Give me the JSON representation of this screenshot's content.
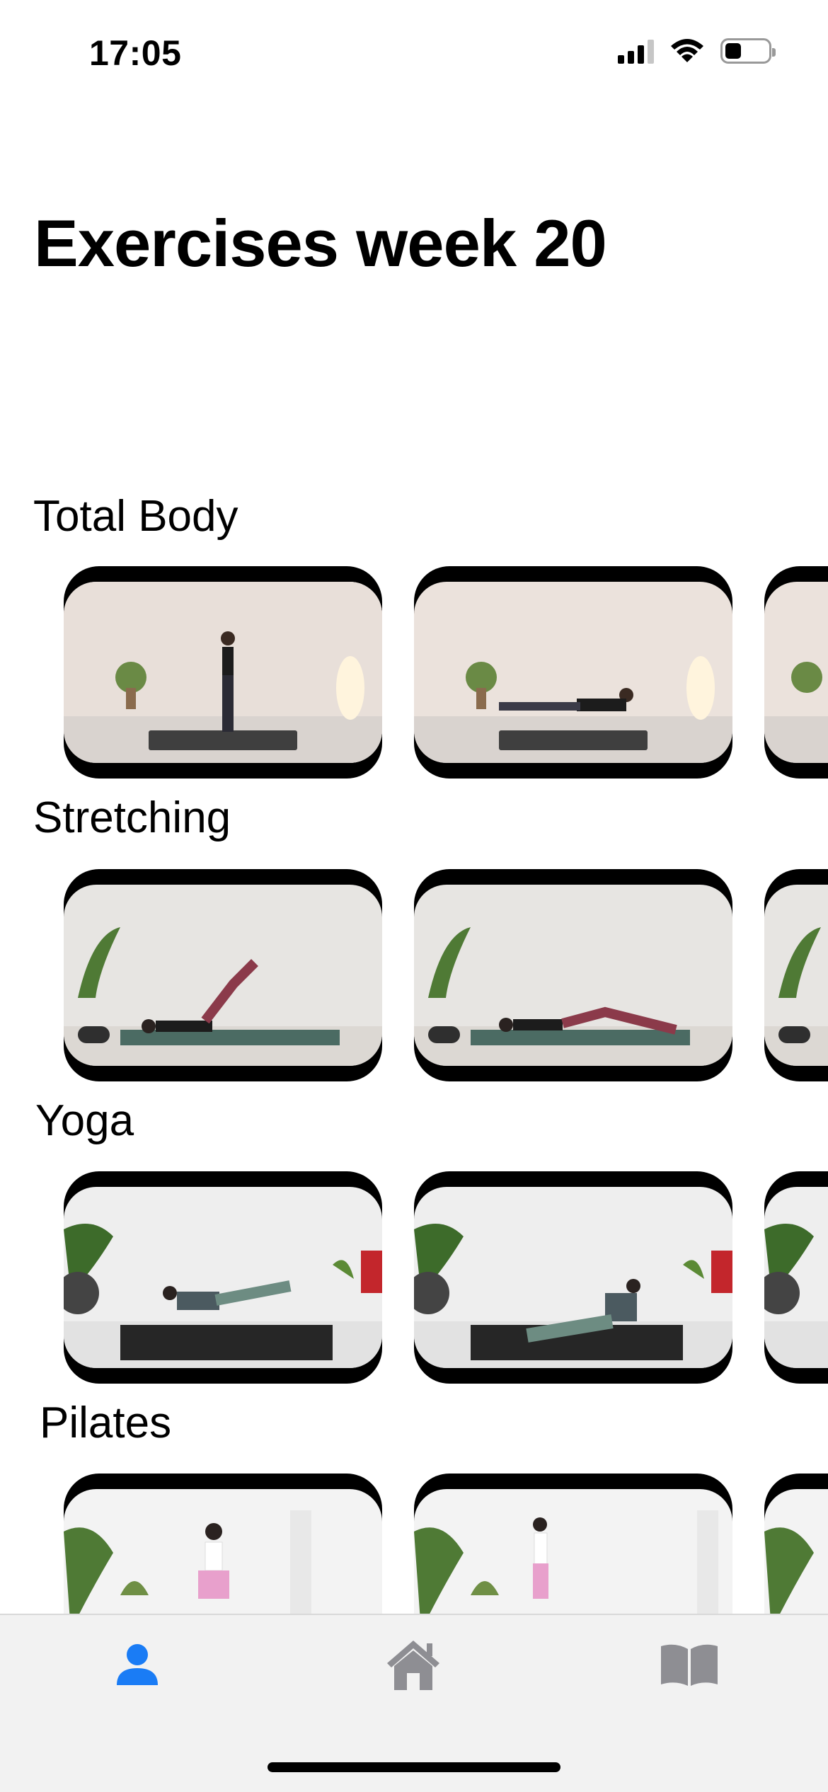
{
  "status_bar": {
    "time": "17:05"
  },
  "page": {
    "title": "Exercises week 20"
  },
  "sections": [
    {
      "label": "Total Body"
    },
    {
      "label": "Stretching"
    },
    {
      "label": "Yoga"
    },
    {
      "label": "Pilates"
    }
  ],
  "tab_bar": {
    "tabs": [
      {
        "icon": "person-icon",
        "selected": true
      },
      {
        "icon": "house-icon",
        "selected": false
      },
      {
        "icon": "book-icon",
        "selected": false
      }
    ]
  },
  "colors": {
    "accent": "#1a7cf5",
    "inactive_tab": "#8e8e93",
    "tab_bar_bg": "#f2f2f2"
  }
}
